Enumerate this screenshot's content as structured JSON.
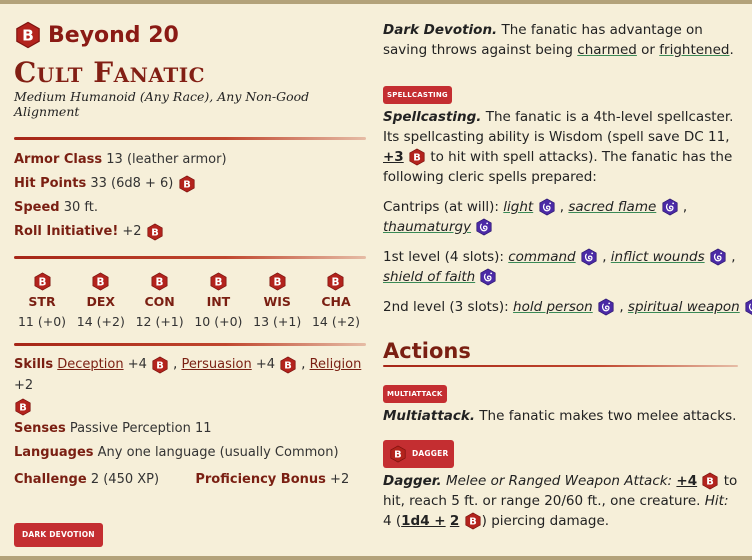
{
  "brand": {
    "name": "Beyond 20"
  },
  "monster": {
    "name": "Cult Fanatic",
    "meta": "Medium Humanoid (Any Race), Any Non-Good Alignment"
  },
  "stats": {
    "armor_class_label": "Armor Class",
    "armor_class_value": "13 (leather armor)",
    "hit_points_label": "Hit Points",
    "hit_points_value": "33 (6d8 + 6)",
    "speed_label": "Speed",
    "speed_value": "30 ft.",
    "initiative_label": "Roll Initiative!",
    "initiative_value": "+2"
  },
  "abilities": [
    {
      "name": "STR",
      "score": "11 (+0)"
    },
    {
      "name": "DEX",
      "score": "14 (+2)"
    },
    {
      "name": "CON",
      "score": "12 (+1)"
    },
    {
      "name": "INT",
      "score": "10 (+0)"
    },
    {
      "name": "WIS",
      "score": "13 (+1)"
    },
    {
      "name": "CHA",
      "score": "14 (+2)"
    }
  ],
  "details": {
    "skills_label": "Skills",
    "skills": [
      {
        "name": "Deception",
        "mod": "+4"
      },
      {
        "name": "Persuasion",
        "mod": "+4"
      },
      {
        "name": "Religion",
        "mod": "+2"
      }
    ],
    "senses_label": "Senses",
    "senses_value": "Passive Perception 11",
    "languages_label": "Languages",
    "languages_value": "Any one language (usually Common)",
    "challenge_label": "Challenge",
    "challenge_value": "2 (450 XP)",
    "prof_label": "Proficiency Bonus",
    "prof_value": "+2"
  },
  "tags": {
    "dark_devotion": "DARK DEVOTION",
    "spellcasting": "SPELLCASTING",
    "multiattack": "MULTIATTACK",
    "dagger": "DAGGER"
  },
  "traits": {
    "dark_devotion_name": "Dark Devotion.",
    "dark_devotion_text_1": "The fanatic has advantage on saving throws against being",
    "charmed": "charmed",
    "or": "or",
    "frightened": "frightened",
    "spellcasting_name": "Spellcasting.",
    "spellcasting_text_1": "The fanatic is a 4th-level spellcaster. Its spellcasting ability is Wisdom (spell save DC 11,",
    "spell_attack_mod": "+3",
    "spellcasting_text_2": "to hit with spell attacks). The fanatic has the following cleric spells prepared:",
    "cantrips_label": "Cantrips (at will):",
    "cantrips": [
      "light",
      "sacred flame",
      "thaumaturgy"
    ],
    "level1_label": "1st level (4 slots):",
    "level1": [
      "command",
      "inflict wounds",
      "shield of faith"
    ],
    "level2_label": "2nd level (3 slots):",
    "level2": [
      "hold person",
      "spiritual weapon"
    ]
  },
  "actions": {
    "heading": "Actions",
    "multiattack_name": "Multiattack.",
    "multiattack_text": "The fanatic makes two melee attacks.",
    "dagger_name": "Dagger.",
    "dagger_type": "Melee or Ranged Weapon Attack:",
    "dagger_hit_mod": "+4",
    "dagger_text_1": "to hit, reach 5 ft. or range 20/60 ft., one creature.",
    "hit_label": "Hit:",
    "dagger_damage_avg": "4",
    "dagger_damage_roll_a": "1d4 +",
    "dagger_damage_roll_b": "2",
    "dagger_damage_type": "piercing damage."
  },
  "colors": {
    "accent_red": "#c42e31",
    "heading_red": "#7a1f12",
    "magic_purple": "#4b2aa6",
    "parchment": "#f6efd9"
  },
  "icons": {
    "dice": "beyond20-d20-icon",
    "magic": "spell-magic-icon"
  }
}
